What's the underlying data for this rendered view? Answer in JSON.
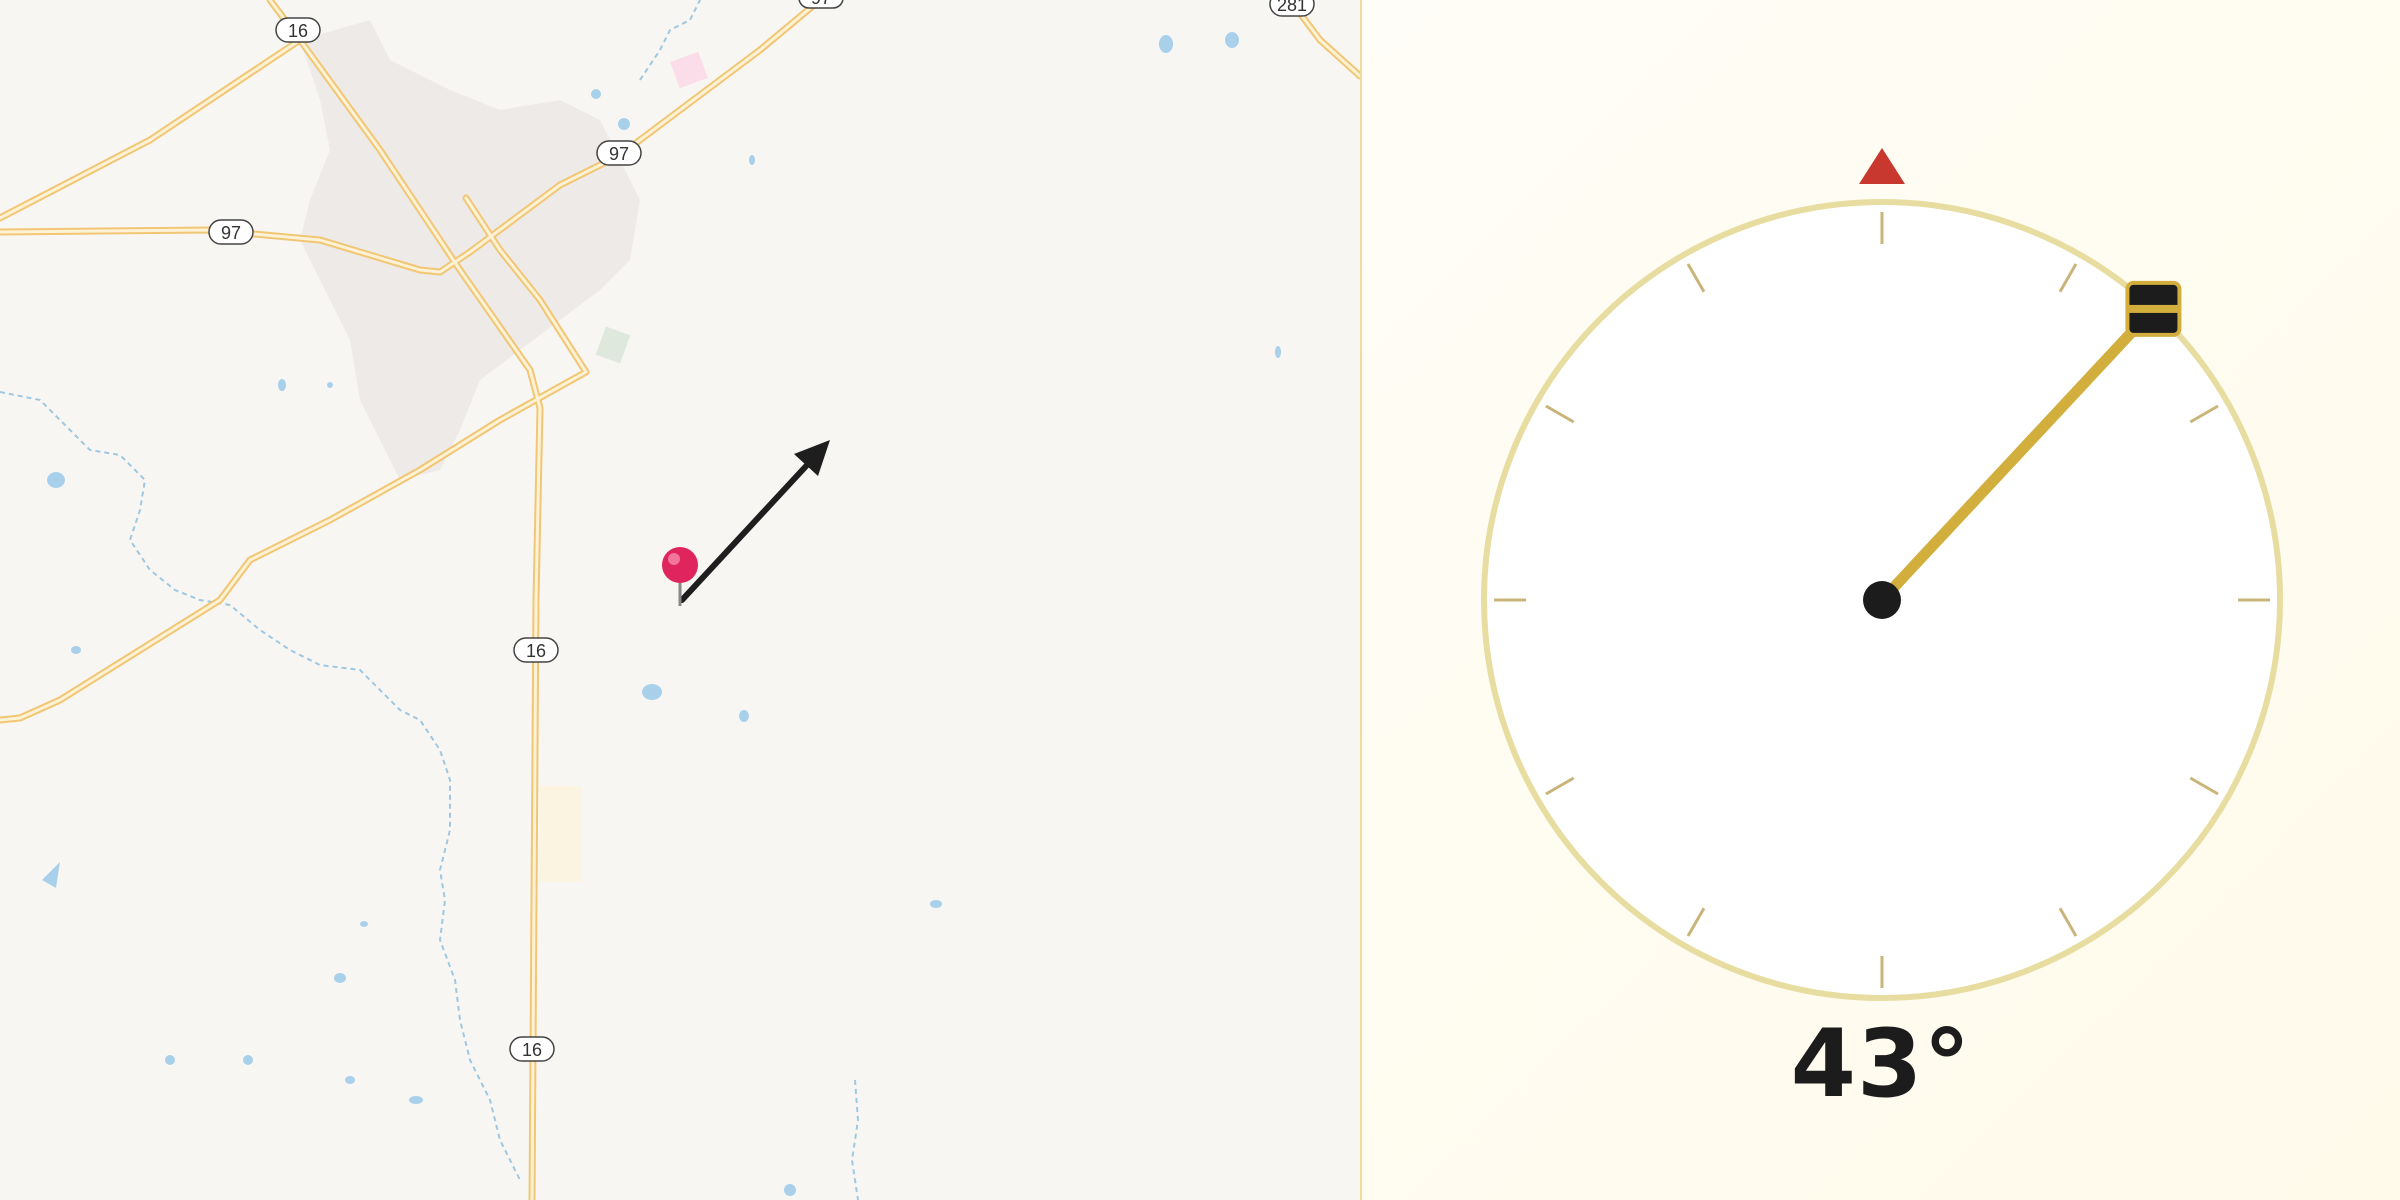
{
  "map": {
    "route_shields": [
      {
        "label": "16"
      },
      {
        "label": "97"
      },
      {
        "label": "97"
      },
      {
        "label": "16"
      },
      {
        "label": "16"
      },
      {
        "label": "97"
      },
      {
        "label": "281"
      }
    ],
    "pin": {
      "icon": "map-pin-icon",
      "color": "#e0245e"
    },
    "direction_arrow": {
      "icon": "direction-arrow-icon",
      "bearing_deg": 43
    }
  },
  "compass": {
    "heading_text": "43°",
    "heading_deg": 43,
    "north_marker_color": "#c8382e",
    "needle_color": "#d2ae3c",
    "ring_color": "#e8dda0",
    "tick_color": "#c9b57a"
  }
}
